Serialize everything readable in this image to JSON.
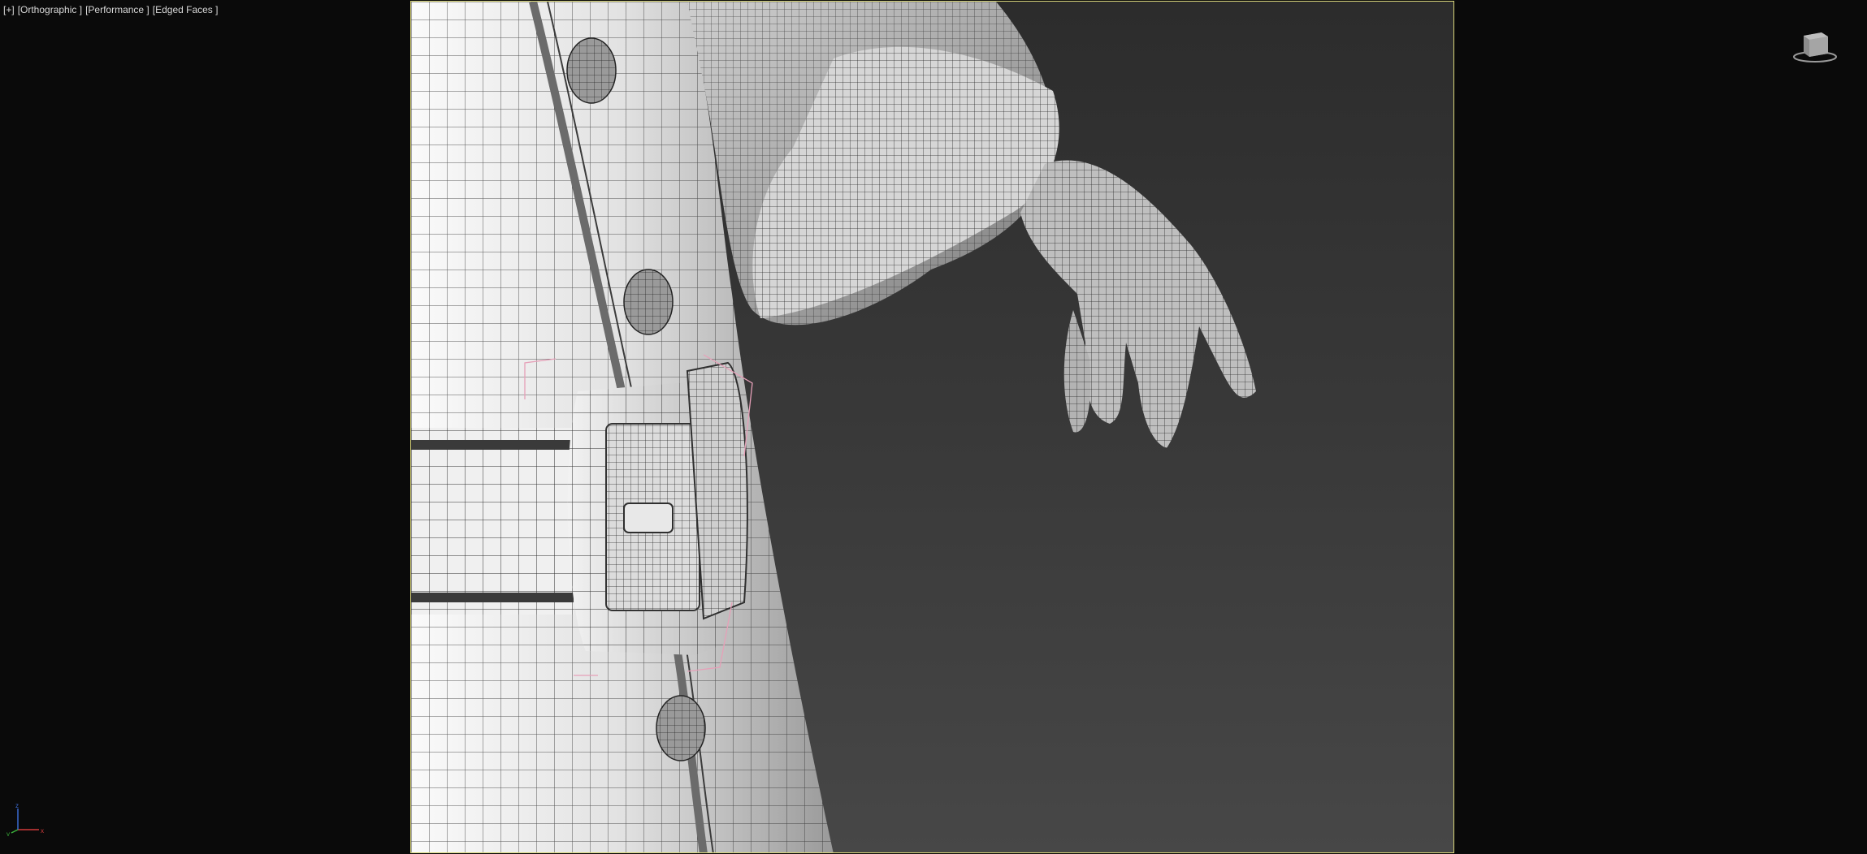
{
  "viewport": {
    "menu_label": "[+]",
    "view_label": "[Orthographic ]",
    "mode_label": "[Performance ]",
    "shading_label": "[Edged Faces ]"
  },
  "axis_gizmo": {
    "x": "x",
    "y": "y",
    "z": "z"
  },
  "colors": {
    "background": "#0a0a0a",
    "viewport_border": "#d8d57a",
    "selection_bracket": "#e6a0b8",
    "mesh_light": "#e9e9e9",
    "mesh_dark": "#6e6e6e"
  }
}
